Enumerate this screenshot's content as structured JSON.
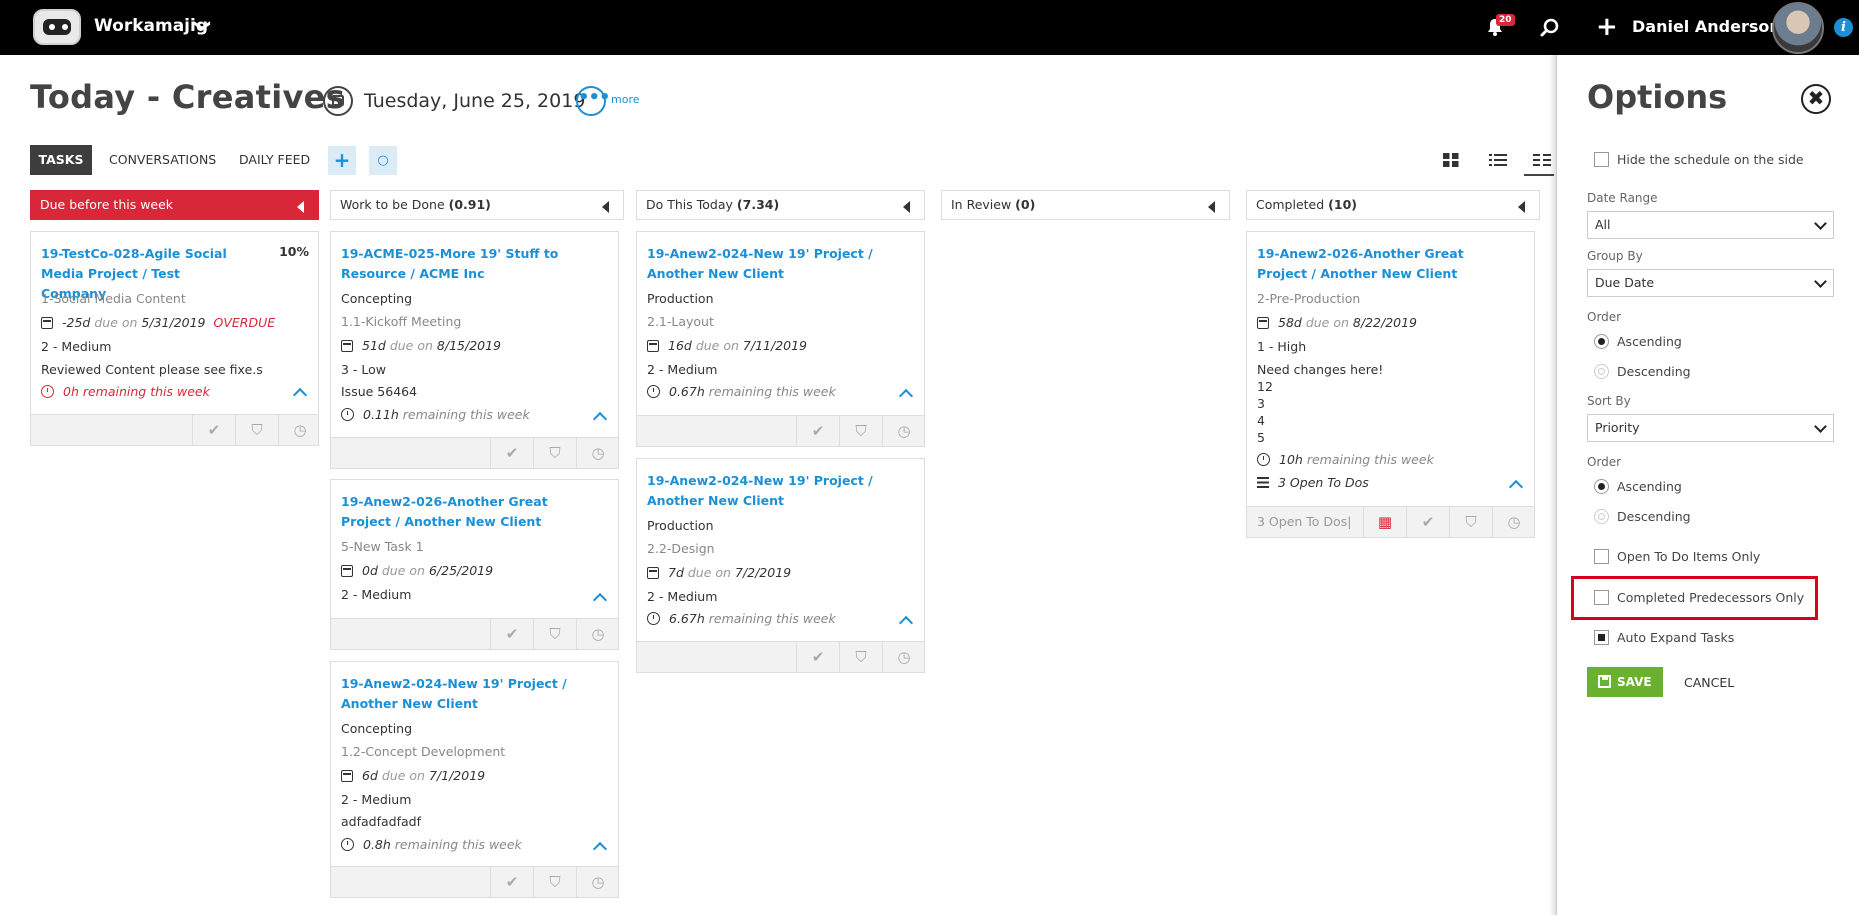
{
  "topbar": {
    "app_name": "Workamajig",
    "app_chevron": "❯",
    "notification_count": "20",
    "plus_symbol": "+",
    "user_name": "Daniel Anderson",
    "info_symbol": "i"
  },
  "header": {
    "title": "Today - Creatives",
    "date": "Tuesday, June 25, 2019",
    "more_dots": "•••",
    "more_label": "more"
  },
  "tabs": {
    "tasks": "TASKS",
    "conversations": "CONVERSATIONS",
    "daily_feed": "DAILY FEED",
    "add_symbol": "+",
    "refresh_symbol": "○"
  },
  "columns": {
    "due": {
      "label": "Due before this week",
      "count": ""
    },
    "work": {
      "label": "Work to be Done",
      "count": "(0.91)"
    },
    "today": {
      "label": "Do This Today",
      "count": "(7.34)"
    },
    "review": {
      "label": "In Review",
      "count": "(0)"
    },
    "completed": {
      "label": "Completed",
      "count": "(10)"
    }
  },
  "cards": {
    "c1": {
      "title": "19-TestCo-028-Agile Social Media Project / Test Company",
      "pct": "10%",
      "task": "1-Social Media Content",
      "days": "-25d",
      "due_word": "due on",
      "due_date": "5/31/2019",
      "overdue": "OVERDUE",
      "priority": "2 - Medium",
      "note": "Reviewed Content please see fixe.s",
      "remaining": "0h remaining this week"
    },
    "c2": {
      "title": "19-ACME-025-More 19' Stuff to Resource / ACME Inc",
      "phase": "Concepting",
      "task": "1.1-Kickoff Meeting",
      "days": "51d",
      "due_word": "due on",
      "due_date": "8/15/2019",
      "priority": "3 - Low",
      "note": "Issue 56464",
      "remaining_hours": "0.11h",
      "remaining_text": "remaining this week"
    },
    "c3": {
      "title": "19-Anew2-026-Another Great Project / Another New Client",
      "task": "5-New Task 1",
      "days": "0d",
      "due_word": "due on",
      "due_date": "6/25/2019",
      "priority": "2 - Medium"
    },
    "c4": {
      "title": "19-Anew2-024-New 19' Project / Another New Client",
      "phase": "Concepting",
      "task": "1.2-Concept Development",
      "days": "6d",
      "due_word": "due on",
      "due_date": "7/1/2019",
      "priority": "2 - Medium",
      "note": "adfadfadfadf",
      "remaining_hours": "0.8h",
      "remaining_text": "remaining this week"
    },
    "c5": {
      "title": "19-Anew2-024-New 19' Project / Another New Client",
      "phase": "Production",
      "task": "2.1-Layout",
      "days": "16d",
      "due_word": "due on",
      "due_date": "7/11/2019",
      "priority": "2 - Medium",
      "remaining_hours": "0.67h",
      "remaining_text": "remaining this week"
    },
    "c6": {
      "title": "19-Anew2-024-New 19' Project / Another New Client",
      "phase": "Production",
      "task": "2.2-Design",
      "days": "7d",
      "due_word": "due on",
      "due_date": "7/2/2019",
      "priority": "2 - Medium",
      "remaining_hours": "6.67h",
      "remaining_text": "remaining this week"
    },
    "c7": {
      "title": "19-Anew2-026-Another Great Project / Another New Client",
      "task": "2-Pre-Production",
      "days": "58d",
      "due_word": "due on",
      "due_date": "8/22/2019",
      "priority": "1 - High",
      "note1": "Need changes here!",
      "note2": "12",
      "note3": "3",
      "note4": "4",
      "note5": "5",
      "remaining_hours": "10h",
      "remaining_text": "remaining this week",
      "todos": "3 Open To Dos",
      "footer_todos": "3 Open To Dos|"
    }
  },
  "footer_icons": {
    "check": "✔",
    "tag": "⛉",
    "clock": "◷",
    "calendar": "▦"
  },
  "options": {
    "title": "Options",
    "close_symbol": "✖",
    "hide_schedule": "Hide the schedule on the side",
    "date_range_label": "Date Range",
    "date_range_value": "All",
    "group_by_label": "Group By",
    "group_by_value": "Due Date",
    "order_label": "Order",
    "ascending": "Ascending",
    "descending": "Descending",
    "sort_by_label": "Sort By",
    "sort_by_value": "Priority",
    "order2_label": "Order",
    "ascending2": "Ascending",
    "descending2": "Descending",
    "open_todo_only": "Open To Do Items Only",
    "completed_predecessors": "Completed Predecessors Only",
    "auto_expand": "Auto Expand Tasks",
    "save": "SAVE",
    "cancel": "CANCEL"
  },
  "colors": {
    "accent": "#1b90d6",
    "alert": "#d9273a",
    "save": "#6ab130"
  }
}
